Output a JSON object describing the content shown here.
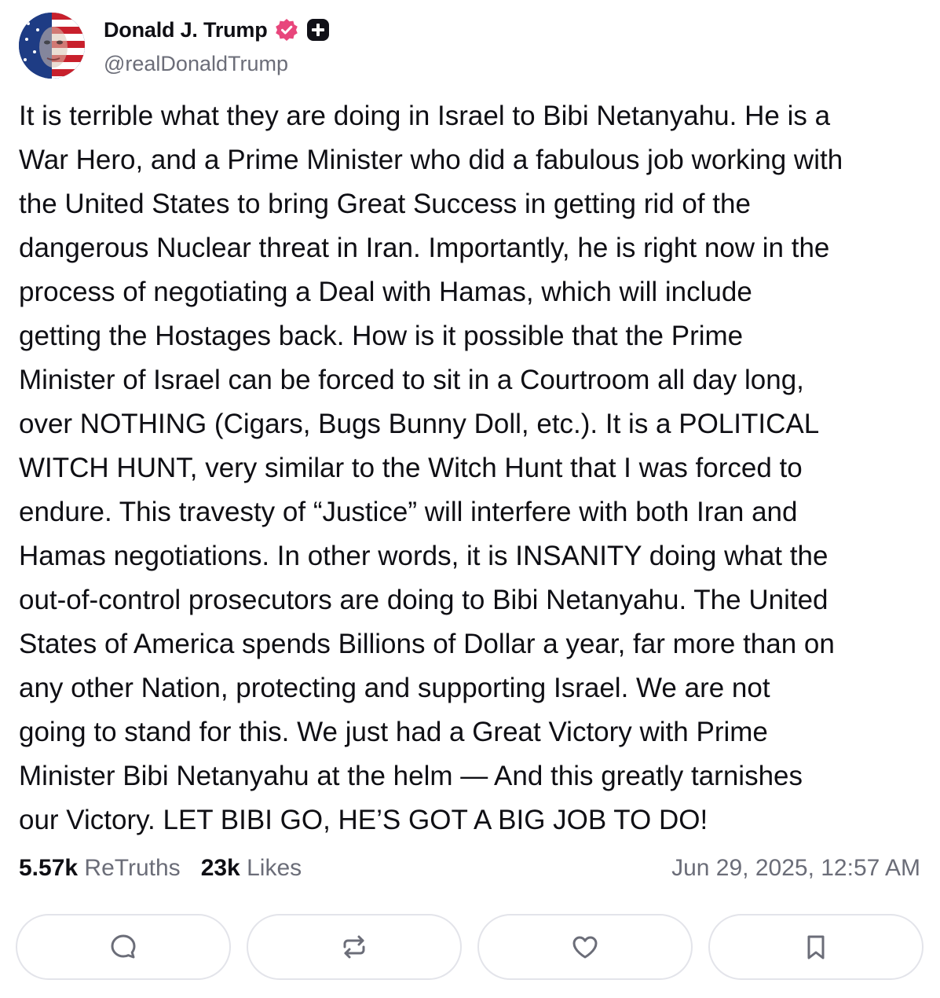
{
  "author": {
    "display_name": "Donald J. Trump",
    "handle": "@realDonaldTrump",
    "verified_icon": "verified-badge-icon",
    "extra_badge_icon": "plus-badge-icon",
    "avatar": "avatar"
  },
  "post": {
    "text": "It is terrible what they are doing in Israel to Bibi Netanyahu. He is a\nWar Hero, and a Prime Minister who did a fabulous job working with\nthe United States to bring Great Success in getting rid of the\ndangerous Nuclear threat in Iran. Importantly, he is right now in the\nprocess of negotiating a Deal with Hamas, which will include\ngetting the Hostages back. How is it possible that the Prime\nMinister of Israel can be forced to sit in a Courtroom all day long,\nover NOTHING (Cigars, Bugs Bunny Doll, etc.). It is a POLITICAL\nWITCH HUNT, very similar to the Witch Hunt that I was forced to\nendure. This travesty of “Justice” will interfere with both Iran and\nHamas negotiations. In other words, it is INSANITY doing what the\nout-of-control prosecutors are doing to Bibi Netanyahu. The United\nStates of America spends Billions of Dollar a year, far more than on\nany other Nation, protecting and supporting Israel. We are not\ngoing to stand for this. We just had a Great Victory with Prime\nMinister Bibi Netanyahu at the helm — And this greatly tarnishes\nour Victory. LET BIBI GO, HE’S GOT A BIG JOB TO DO!"
  },
  "stats": {
    "retruths_count": "5.57k",
    "retruths_label": "ReTruths",
    "likes_count": "23k",
    "likes_label": "Likes",
    "timestamp": "Jun 29, 2025, 12:57 AM"
  },
  "actions": [
    {
      "icon": "reply-icon"
    },
    {
      "icon": "retruth-icon"
    },
    {
      "icon": "like-icon"
    },
    {
      "icon": "bookmark-icon"
    }
  ],
  "colors": {
    "text": "#0f0f14",
    "muted": "#6b6d78",
    "verified": "#e8467c",
    "border": "#e3e4ea",
    "icon": "#6b6d78"
  }
}
